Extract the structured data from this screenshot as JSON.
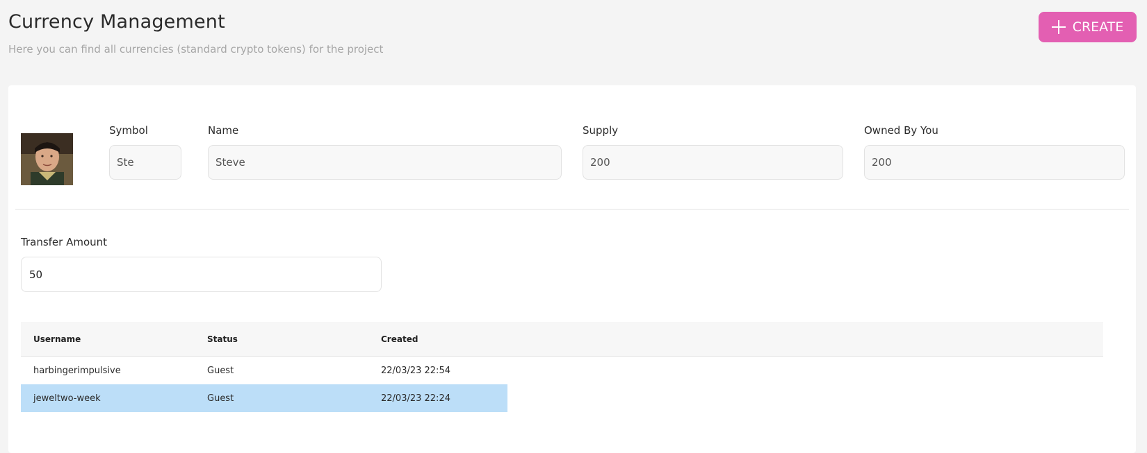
{
  "header": {
    "title": "Currency Management",
    "subtitle": "Here you can find all currencies (standard crypto tokens) for the project",
    "create_label": "CREATE"
  },
  "currency": {
    "symbol_label": "Symbol",
    "symbol_value": "Ste",
    "name_label": "Name",
    "name_value": "Steve",
    "supply_label": "Supply",
    "supply_value": "200",
    "owned_label": "Owned By You",
    "owned_value": "200"
  },
  "transfer": {
    "label": "Transfer Amount",
    "value": "50"
  },
  "table": {
    "columns": [
      "Username",
      "Status",
      "Created"
    ],
    "rows": [
      {
        "username": "harbingerimpulsive",
        "status": "Guest",
        "created": "22/03/23 22:54"
      },
      {
        "username": "jeweltwo-week",
        "status": "Guest",
        "created": "22/03/23 22:24"
      }
    ]
  },
  "colors": {
    "accent": "#e35fb2",
    "selected_row": "#bcdef8",
    "background": "#f4f4f4"
  }
}
